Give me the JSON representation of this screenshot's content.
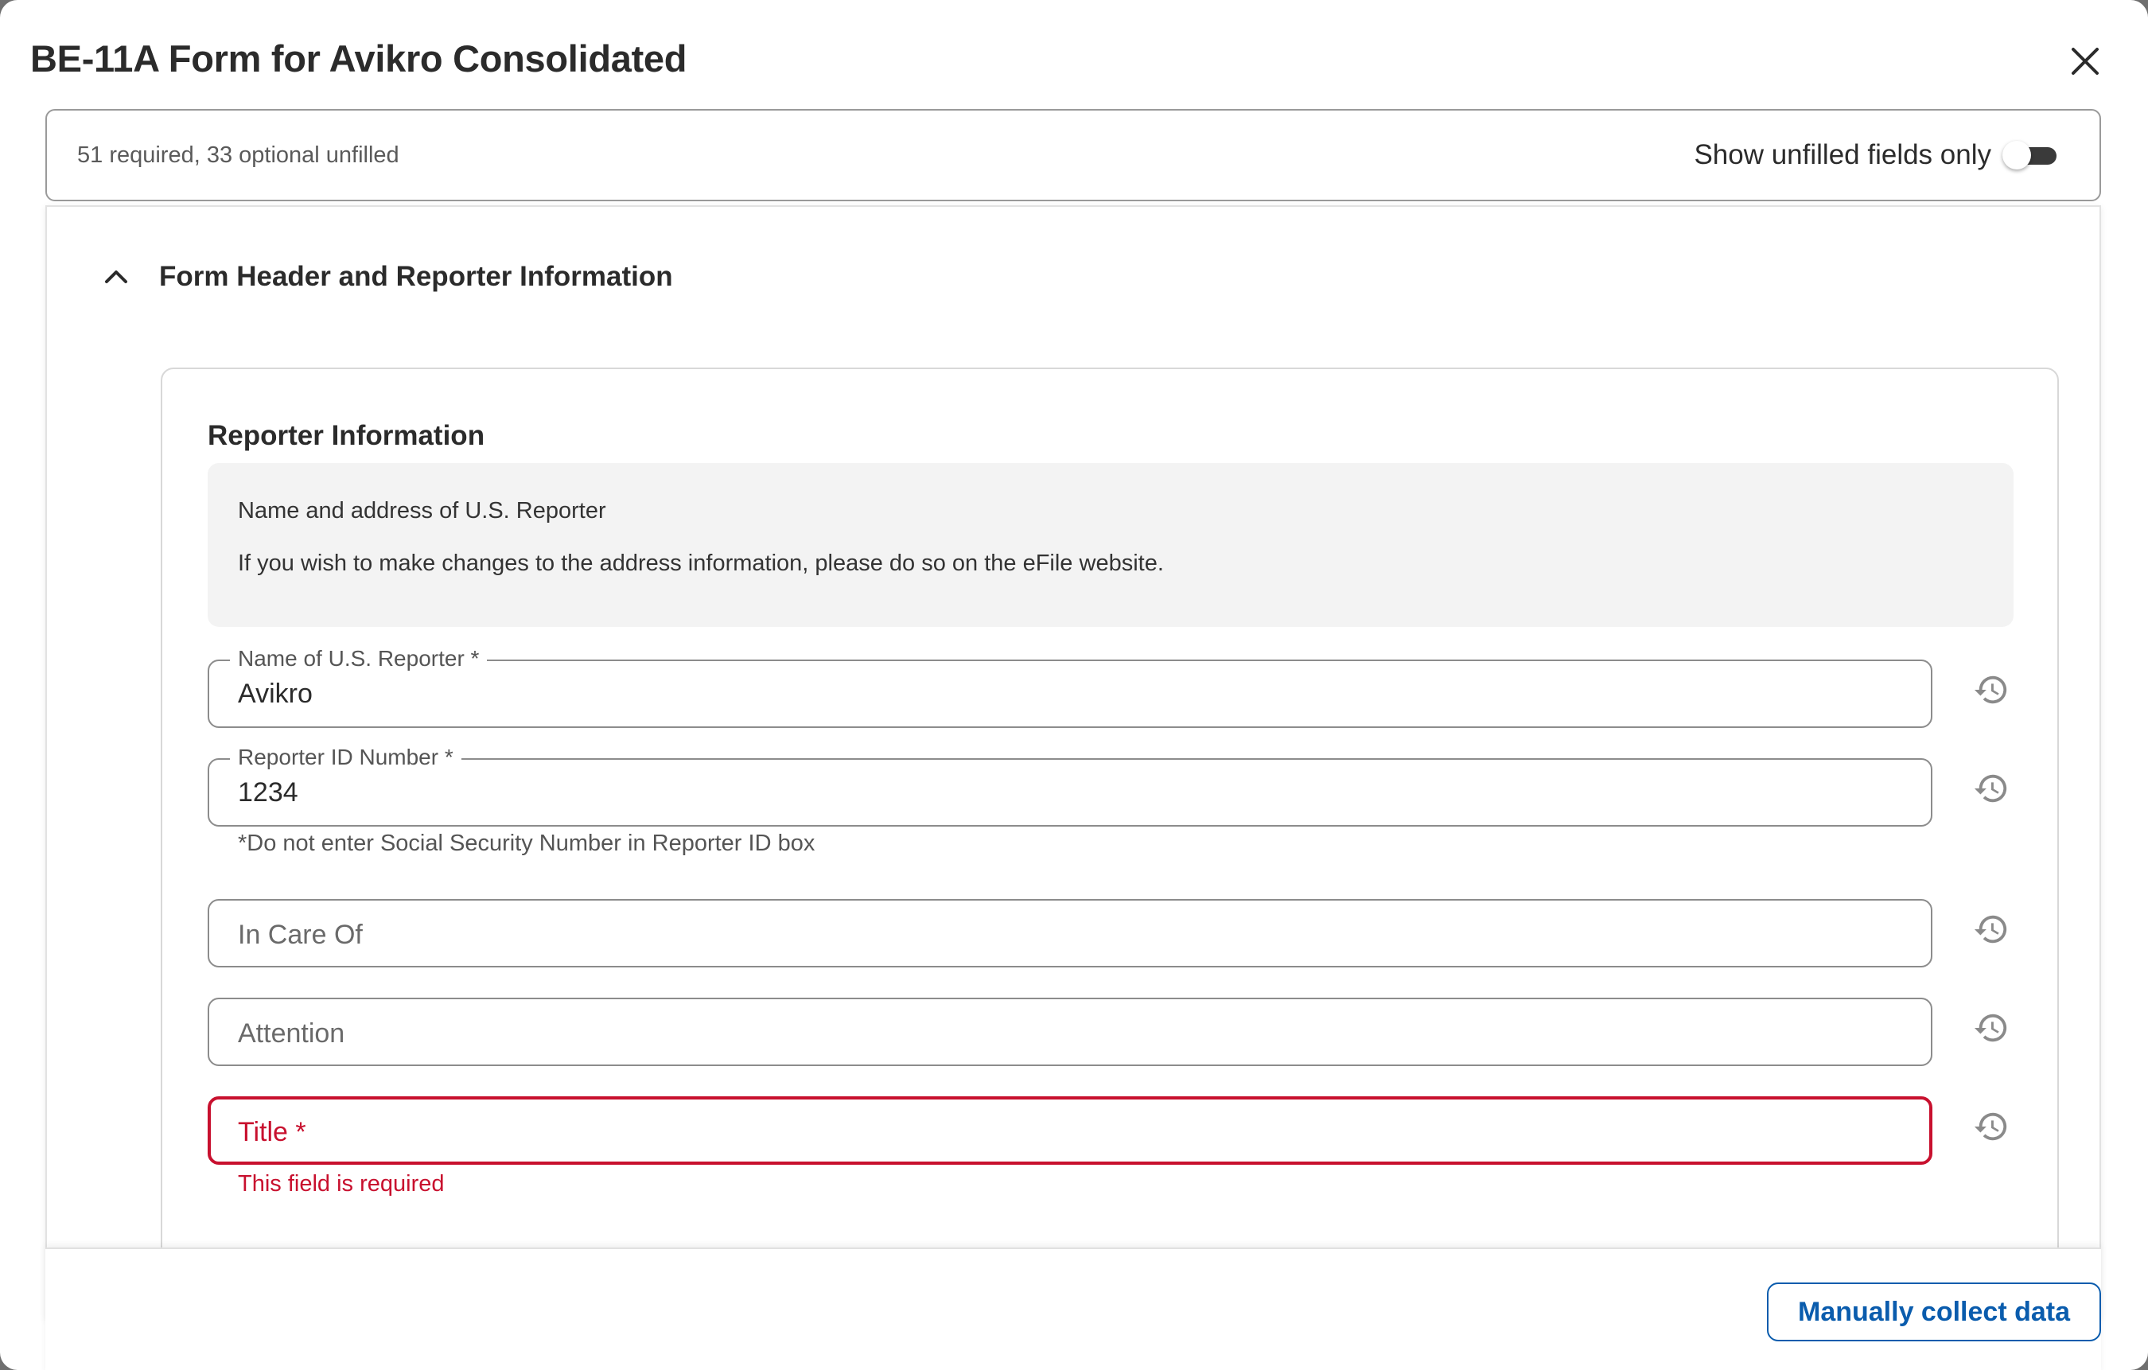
{
  "modal": {
    "title": "BE-11A Form for Avikro Consolidated"
  },
  "summary": {
    "unfilled_text": "51 required, 33 optional unfilled",
    "toggle_label": "Show unfilled fields only",
    "toggle_on": false
  },
  "section": {
    "title": "Form Header and Reporter Information",
    "expanded": true
  },
  "card": {
    "title": "Reporter Information",
    "info_line1": "Name and address of U.S. Reporter",
    "info_line2": "If you wish to make changes to the address information, please do so on the eFile website."
  },
  "fields": {
    "name": {
      "label": "Name of U.S. Reporter *",
      "value": "Avikro"
    },
    "reporter_id": {
      "label": "Reporter ID Number *",
      "value": "1234",
      "helper": "*Do not enter Social Security Number in Reporter ID box"
    },
    "in_care_of": {
      "placeholder": "In Care Of"
    },
    "attention": {
      "placeholder": "Attention"
    },
    "title": {
      "placeholder": "Title *",
      "error": "This field is required"
    }
  },
  "footer": {
    "button_label": "Manually collect data"
  },
  "icons": {
    "close": "close-icon",
    "chevron": "chevron-up-icon",
    "history": "history-icon"
  },
  "colors": {
    "error": "#c8102e",
    "accent": "#0a5cad",
    "info_bg": "#f3f3f3"
  }
}
